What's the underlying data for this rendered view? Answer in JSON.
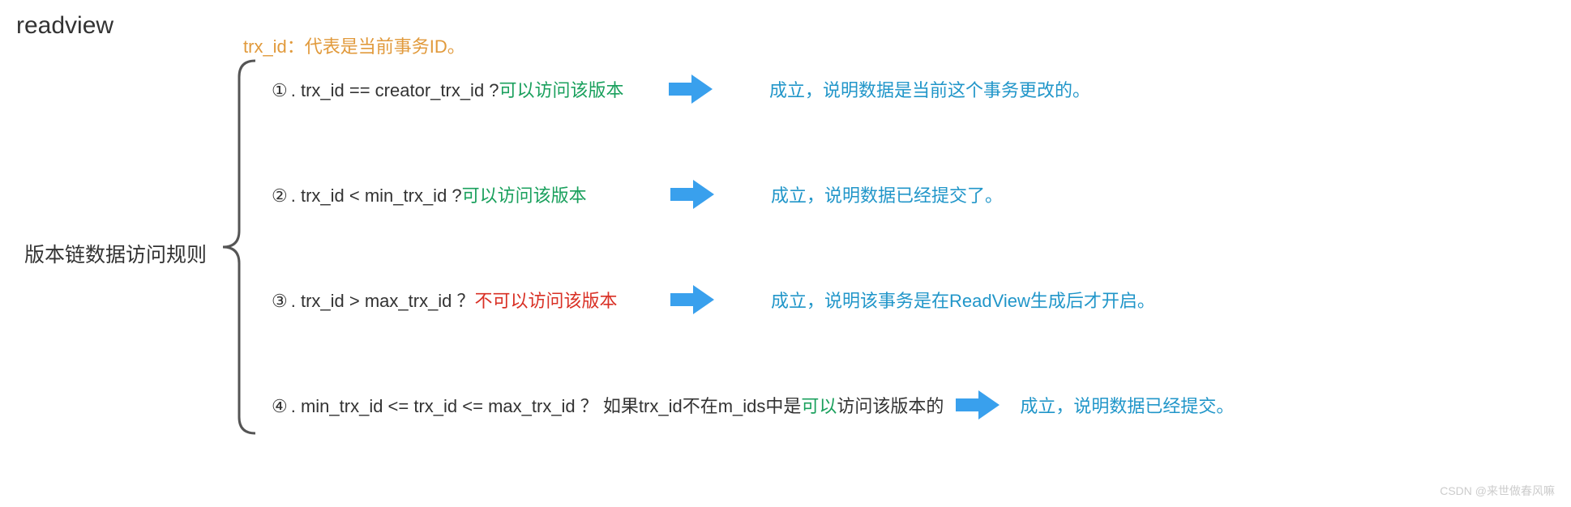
{
  "title": "readview",
  "subtitle": "trx_id：代表是当前事务ID。",
  "left_label": "版本链数据访问规则",
  "colors": {
    "green": "#1aa05d",
    "red": "#d93025",
    "blue": "#2196c9",
    "orange": "#e19a3c",
    "arrow": "#39a0ed"
  },
  "rules": [
    {
      "index": "①",
      "condition": ". trx_id  == creator_trx_id ? ",
      "result": "可以访问该版本",
      "result_type": "can",
      "explanation": "成立，说明数据是当前这个事务更改的。"
    },
    {
      "index": "②",
      "condition": ". trx_id < min_trx_id ? ",
      "result": "可以访问该版本",
      "result_type": "can",
      "explanation": "成立，说明数据已经提交了。"
    },
    {
      "index": "③",
      "condition": ". trx_id > max_trx_id ？ ",
      "result": "不可以访问该版本",
      "result_type": "cannot",
      "explanation": "成立，说明该事务是在ReadView生成后才开启。"
    },
    {
      "index": "④",
      "condition_prefix": ". min_trx_id <= trx_id <= max_trx_id ？ 如果trx_id不在m_ids中是",
      "condition_mid": "可以",
      "condition_suffix": "访问该版本的",
      "explanation": "成立，说明数据已经提交。"
    }
  ],
  "watermark": "CSDN @来世做春风嘛"
}
